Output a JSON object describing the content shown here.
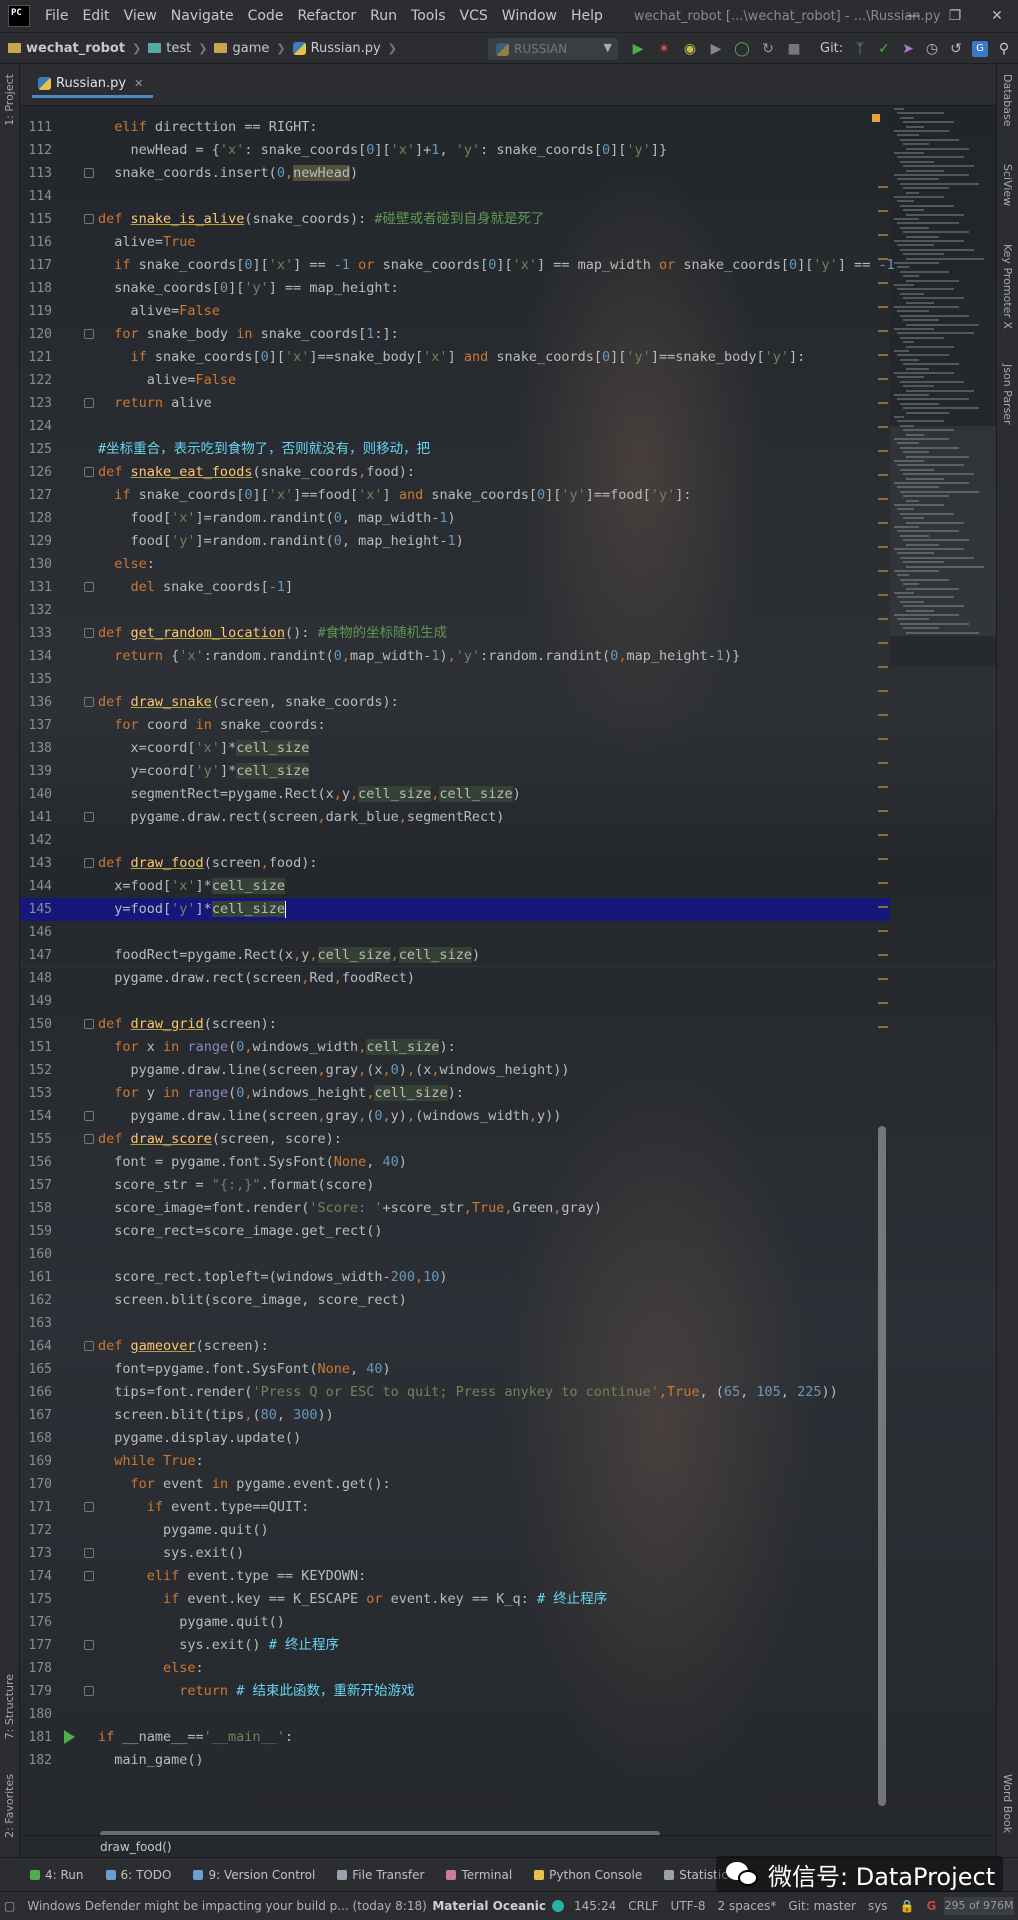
{
  "menubar": {
    "logo": "PC",
    "items": [
      "File",
      "Edit",
      "View",
      "Navigate",
      "Code",
      "Refactor",
      "Run",
      "Tools",
      "VCS",
      "Window",
      "Help"
    ],
    "title": "wechat_robot [...\\wechat_robot] - ...\\Russian.py"
  },
  "navbar": {
    "project": "wechat_robot",
    "crumbs": [
      "test",
      "game",
      "Russian.py"
    ],
    "run_config": "RUSSIAN",
    "git_label": "Git:"
  },
  "left_tabs": [
    "1: Project",
    "7: Structure",
    "2: Favorites"
  ],
  "right_tabs": [
    "Database",
    "SciView",
    "Key Promoter X",
    "Json Parser",
    "Word Book"
  ],
  "tab": {
    "label": "Russian.py"
  },
  "editor": {
    "current_line": 145,
    "lines": [
      {
        "n": 111,
        "html": "  <span class='kw'>elif</span> directtion == RIGHT:"
      },
      {
        "n": 112,
        "html": "    newHead = {<span class='st'>'x'</span>: snake_coords[<span class='nu'>0</span>][<span class='st'>'x'</span>]+<span class='nu'>1</span>, <span class='st'>'y'</span>: snake_coords[<span class='nu'>0</span>][<span class='st'>'y'</span>]}"
      },
      {
        "n": 113,
        "html": "  snake_coords.insert(<span class='nu'>0</span><span class='kw'>,</span><span class='hlo'>newHead</span>)"
      },
      {
        "n": 114,
        "html": ""
      },
      {
        "n": 115,
        "html": "<span class='kw'>def</span> <span class='fn un'>snake_is_alive</span>(snake_coords): <span class='cm'>#碰壁或者碰到自身就是死了</span>"
      },
      {
        "n": 116,
        "html": "  alive=<span class='kw'>True</span>"
      },
      {
        "n": 117,
        "html": "  <span class='kw'>if</span> snake_coords[<span class='nu'>0</span>][<span class='st'>'x'</span>] == <span class='nu'>-1</span> <span class='kw'>or</span> snake_coords[<span class='nu'>0</span>][<span class='st'>'x'</span>] == map_width <span class='kw'>or</span> snake_coords[<span class='nu'>0</span>][<span class='st'>'y'</span>] == <span class='nu'>-1</span>"
      },
      {
        "n": 118,
        "html": "  snake_coords[<span class='nu'>0</span>][<span class='st'>'y'</span>] == map_height:"
      },
      {
        "n": 119,
        "html": "    alive=<span class='kw'>False</span>"
      },
      {
        "n": 120,
        "html": "  <span class='kw'>for</span> snake_body <span class='kw'>in</span> snake_coords[<span class='nu'>1</span>:]:"
      },
      {
        "n": 121,
        "html": "    <span class='kw'>if</span> snake_coords[<span class='nu'>0</span>][<span class='st'>'x'</span>]==snake_body[<span class='st'>'x'</span>] <span class='kw'>and</span> snake_coords[<span class='nu'>0</span>][<span class='st'>'y'</span>]==snake_body[<span class='st'>'y'</span>]:"
      },
      {
        "n": 122,
        "html": "      alive=<span class='kw'>False</span>"
      },
      {
        "n": 123,
        "html": "  <span class='kw'>return</span> alive"
      },
      {
        "n": 124,
        "html": ""
      },
      {
        "n": 125,
        "html": "<span class='ch'>#坐标重合，表示吃到食物了，否则就没有，则移动，把</span>"
      },
      {
        "n": 126,
        "html": "<span class='kw'>def</span> <span class='fn un'>snake_eat_foods</span>(snake_coords<span class='kw'>,</span>food):"
      },
      {
        "n": 127,
        "html": "  <span class='kw'>if</span> snake_coords[<span class='nu'>0</span>][<span class='st'>'x'</span>]==food[<span class='st'>'x'</span>] <span class='kw'>and</span> snake_coords[<span class='nu'>0</span>][<span class='st'>'y'</span>]==food[<span class='st'>'y'</span>]:"
      },
      {
        "n": 128,
        "html": "    food[<span class='st'>'x'</span>]=random.randint(<span class='nu'>0</span>, map_width-<span class='nu'>1</span>)"
      },
      {
        "n": 129,
        "html": "    food[<span class='st'>'y'</span>]=random.randint(<span class='nu'>0</span>, map_height-<span class='nu'>1</span>)"
      },
      {
        "n": 130,
        "html": "  <span class='kw'>else</span>:"
      },
      {
        "n": 131,
        "html": "    <span class='kw'>del</span> snake_coords[<span class='nu'>-1</span>]"
      },
      {
        "n": 132,
        "html": ""
      },
      {
        "n": 133,
        "html": "<span class='kw'>def</span> <span class='fn un'>get_random_location</span>(): <span class='cm'>#食物的坐标随机生成</span>"
      },
      {
        "n": 134,
        "html": "  <span class='kw'>return</span> {<span class='st'>'x'</span>:random.randint(<span class='nu'>0</span><span class='kw'>,</span>map_width-<span class='nu'>1</span>)<span class='kw'>,</span><span class='st'>'y'</span>:random.randint(<span class='nu'>0</span><span class='kw'>,</span>map_height-<span class='nu'>1</span>)}"
      },
      {
        "n": 135,
        "html": ""
      },
      {
        "n": 136,
        "html": "<span class='kw'>def</span> <span class='fn un'>draw_snake</span>(screen, snake_coords):"
      },
      {
        "n": 137,
        "html": "  <span class='kw'>for</span> coord <span class='kw'>in</span> snake_coords:"
      },
      {
        "n": 138,
        "html": "    x=coord[<span class='st'>'x'</span>]*<span class='hl'>cell_size</span>"
      },
      {
        "n": 139,
        "html": "    y=coord[<span class='st'>'y'</span>]*<span class='hl'>cell_size</span>"
      },
      {
        "n": 140,
        "html": "    segmentRect=pygame.Rect(x<span class='kw'>,</span>y<span class='kw'>,</span><span class='hl'>cell_size</span><span class='kw'>,</span><span class='hl'>cell_size</span>)"
      },
      {
        "n": 141,
        "html": "    pygame.draw.rect(screen<span class='kw'>,</span>dark_blue<span class='kw'>,</span>segmentRect)"
      },
      {
        "n": 142,
        "html": ""
      },
      {
        "n": 143,
        "html": "<span class='kw'>def</span> <span class='fn un'>draw_food</span>(screen<span class='kw'>,</span>food):"
      },
      {
        "n": 144,
        "html": "  x=food[<span class='st'>'x'</span>]*<span class='hl'>cell_size</span>"
      },
      {
        "n": 145,
        "html": "  y=food[<span class='st'>'y'</span>]*<span class='hl'>cell_size</span><span class='caret'></span>"
      },
      {
        "n": 146,
        "html": ""
      },
      {
        "n": 147,
        "html": "  foodRect=pygame.Rect(x<span class='kw'>,</span>y<span class='kw'>,</span><span class='hl'>cell_size</span><span class='kw'>,</span><span class='hl'>cell_size</span>)"
      },
      {
        "n": 148,
        "html": "  pygame.draw.rect(screen<span class='kw'>,</span>Red<span class='kw'>,</span>foodRect)"
      },
      {
        "n": 149,
        "html": ""
      },
      {
        "n": 150,
        "html": "<span class='kw'>def</span> <span class='fn un'>draw_grid</span>(screen):"
      },
      {
        "n": 151,
        "html": "  <span class='kw'>for</span> x <span class='kw'>in</span> <span class='bi'>range</span>(<span class='nu'>0</span><span class='kw'>,</span>windows_width<span class='kw'>,</span><span class='hl'>cell_size</span>):"
      },
      {
        "n": 152,
        "html": "    pygame.draw.line(screen<span class='kw'>,</span>gray<span class='kw'>,</span>(x<span class='kw'>,</span><span class='nu'>0</span>)<span class='kw'>,</span>(x<span class='kw'>,</span>windows_height))"
      },
      {
        "n": 153,
        "html": "  <span class='kw'>for</span> y <span class='kw'>in</span> <span class='bi'>range</span>(<span class='nu'>0</span><span class='kw'>,</span>windows_height<span class='kw'>,</span><span class='hl'>cell_size</span>):"
      },
      {
        "n": 154,
        "html": "    pygame.draw.line(screen<span class='kw'>,</span>gray<span class='kw'>,</span>(<span class='nu'>0</span><span class='kw'>,</span>y)<span class='kw'>,</span>(windows_width<span class='kw'>,</span>y))"
      },
      {
        "n": 155,
        "html": "<span class='kw'>def</span> <span class='fn un'>draw_score</span>(screen, score):"
      },
      {
        "n": 156,
        "html": "  font = pygame.font.SysFont(<span class='kw'>None</span>, <span class='nu'>40</span>)"
      },
      {
        "n": 157,
        "html": "  score_str = <span class='st'>\"{:,}\"</span>.format(score)"
      },
      {
        "n": 158,
        "html": "  score_image=font.render(<span class='st'>'Score: '</span>+score_str<span class='kw'>,</span><span class='kw'>True</span><span class='kw'>,</span>Green<span class='kw'>,</span>gray)"
      },
      {
        "n": 159,
        "html": "  score_rect=score_image.get_rect()"
      },
      {
        "n": 160,
        "html": ""
      },
      {
        "n": 161,
        "html": "  score_rect.topleft=(windows_width-<span class='nu'>200</span><span class='kw'>,</span><span class='nu'>10</span>)"
      },
      {
        "n": 162,
        "html": "  screen.blit(score_image, score_rect)"
      },
      {
        "n": 163,
        "html": ""
      },
      {
        "n": 164,
        "html": "<span class='kw'>def</span> <span class='fn un'>gameover</span>(screen):"
      },
      {
        "n": 165,
        "html": "  font=pygame.font.SysFont(<span class='kw'>None</span>, <span class='nu'>40</span>)"
      },
      {
        "n": 166,
        "html": "  tips=font.render(<span class='st'>'Press Q or ESC to quit; Press anykey to continue'</span><span class='kw'>,</span><span class='kw'>True</span>, (<span class='nu'>65</span>, <span class='nu'>105</span>, <span class='nu'>225</span>))"
      },
      {
        "n": 167,
        "html": "  screen.blit(tips<span class='kw'>,</span>(<span class='nu'>80</span>, <span class='nu'>300</span>))"
      },
      {
        "n": 168,
        "html": "  pygame.display.update()"
      },
      {
        "n": 169,
        "html": "  <span class='kw'>while</span> <span class='kw'>True</span>:"
      },
      {
        "n": 170,
        "html": "    <span class='kw'>for</span> event <span class='kw'>in</span> pygame.event.get():"
      },
      {
        "n": 171,
        "html": "      <span class='kw'>if</span> event.type==QUIT:"
      },
      {
        "n": 172,
        "html": "        pygame.quit()"
      },
      {
        "n": 173,
        "html": "        sys.exit()"
      },
      {
        "n": 174,
        "html": "      <span class='kw'>elif</span> event.type == KEYDOWN:"
      },
      {
        "n": 175,
        "html": "        <span class='kw'>if</span> event.key == K_ESCAPE <span class='kw'>or</span> event.key == K_q: <span class='ch'># 终止程序</span>"
      },
      {
        "n": 176,
        "html": "          pygame.quit()"
      },
      {
        "n": 177,
        "html": "          sys.exit() <span class='ch'># 终止程序</span>"
      },
      {
        "n": 178,
        "html": "        <span class='kw'>else</span>:"
      },
      {
        "n": 179,
        "html": "          <span class='kw'>return</span> <span class='ch'># 结束此函数，重新开始游戏</span>"
      },
      {
        "n": 180,
        "html": ""
      },
      {
        "n": 181,
        "html": "<span class='kw'>if</span> __name__==<span class='st'>'__main__'</span>:"
      },
      {
        "n": 182,
        "html": "  main_game()"
      }
    ]
  },
  "code_breadcrumb": "draw_food()",
  "tool_windows": [
    {
      "label": "4: Run",
      "color": "#4cae4c"
    },
    {
      "label": "6: TODO",
      "color": "#6a9fd4"
    },
    {
      "label": "9: Version Control",
      "color": "#6a9fd4"
    },
    {
      "label": "File Transfer",
      "color": "#9aa3ad"
    },
    {
      "label": "Terminal",
      "color": "#cc7a9a"
    },
    {
      "label": "Python Console",
      "color": "#e6c24a"
    },
    {
      "label": "Statistic",
      "color": "#9aa3ad"
    }
  ],
  "status": {
    "message": "Windows Defender might be impacting your build p... (today 8:18)",
    "theme": "Material Oceanic",
    "position": "145:24",
    "line_sep": "CRLF",
    "encoding": "UTF-8",
    "indent": "2 spaces*",
    "git": "Git: master",
    "sys": "sys",
    "memory": "295 of 976M"
  },
  "watermark": {
    "text": "微信号: DataProject"
  },
  "colors": {
    "current_line": "#16177a",
    "keyword": "#cc7832",
    "function": "#ffc66d",
    "string": "#6a8759",
    "number": "#6897bb"
  }
}
